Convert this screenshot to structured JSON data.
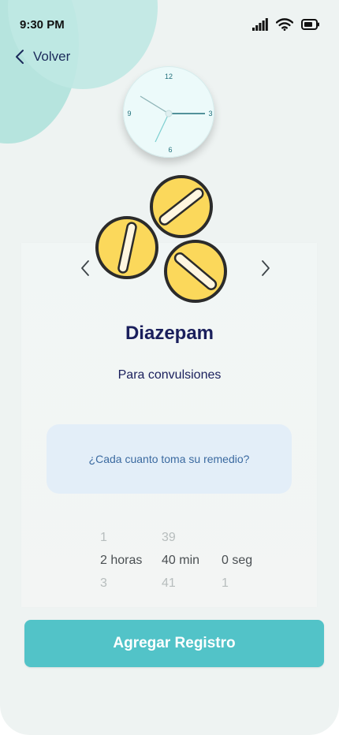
{
  "status_bar": {
    "time": "9:30 PM"
  },
  "nav": {
    "back_label": "Volver"
  },
  "clock": {
    "numerals": {
      "n12": "12",
      "n3": "3",
      "n6": "6",
      "n9": "9"
    }
  },
  "medication": {
    "name": "Diazepam",
    "purpose": "Para convulsiones"
  },
  "question": {
    "text": "¿Cada cuanto toma su remedio?"
  },
  "picker": {
    "hours": {
      "prev": "1",
      "selected": "2 horas",
      "next": "3"
    },
    "minutes": {
      "prev": "39",
      "selected": "40 min",
      "next": "41"
    },
    "seconds": {
      "prev": "",
      "selected": "0 seg",
      "next": "1"
    }
  },
  "actions": {
    "primary_label": "Agregar Registro"
  },
  "colors": {
    "accent": "#52c3c8",
    "title": "#1a1f5c",
    "pill": "#fbd85b",
    "question_bg": "#e3eef8"
  }
}
